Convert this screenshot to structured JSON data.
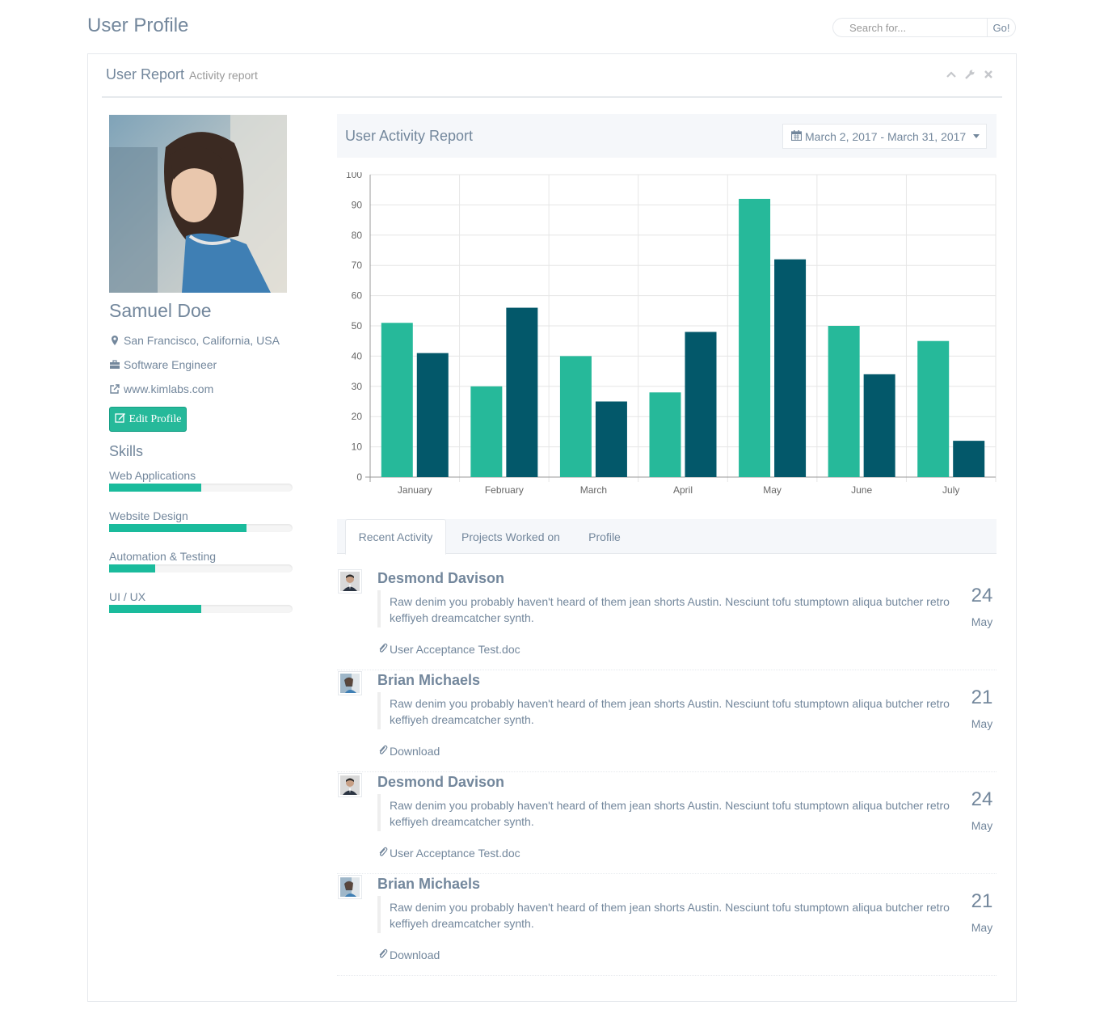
{
  "page": {
    "title": "User Profile"
  },
  "search": {
    "placeholder": "Search for...",
    "button": "Go!"
  },
  "panel": {
    "title": "User Report",
    "subtitle": "Activity report",
    "tools": [
      "chevron-up-icon",
      "wrench-icon",
      "close-icon"
    ]
  },
  "profile": {
    "name": "Samuel Doe",
    "location": "San Francisco, California, USA",
    "job": "Software Engineer",
    "website": "www.kimlabs.com",
    "edit_label": "Edit Profile",
    "skills_title": "Skills",
    "skills": [
      {
        "label": "Web Applications",
        "percent": 50
      },
      {
        "label": "Website Design",
        "percent": 75
      },
      {
        "label": "Automation & Testing",
        "percent": 25
      },
      {
        "label": "UI / UX",
        "percent": 50
      }
    ]
  },
  "report": {
    "title": "User Activity Report",
    "date_range": "March 2, 2017 - March 31, 2017"
  },
  "chart_data": {
    "type": "bar",
    "categories": [
      "January",
      "February",
      "March",
      "April",
      "May",
      "June",
      "July"
    ],
    "series": [
      {
        "values": [
          51,
          30,
          40,
          28,
          92,
          50,
          45
        ],
        "color": "#26B99A"
      },
      {
        "values": [
          41,
          56,
          25,
          48,
          72,
          34,
          12
        ],
        "color": "#03586A"
      }
    ],
    "ylim": [
      0,
      100
    ],
    "yticks": [
      0,
      10,
      20,
      30,
      40,
      50,
      60,
      70,
      80,
      90,
      100
    ],
    "grid": true
  },
  "tabs": [
    {
      "label": "Recent Activity",
      "active": true
    },
    {
      "label": "Projects Worked on",
      "active": false
    },
    {
      "label": "Profile",
      "active": false
    }
  ],
  "activities": [
    {
      "name": "Desmond Davison",
      "text": "Raw denim you probably haven't heard of them jean shorts Austin. Nesciunt tofu stumptown aliqua butcher retro keffiyeh dreamcatcher synth.",
      "attachment": "User Acceptance Test.doc",
      "day": "24",
      "month": "May"
    },
    {
      "name": "Brian Michaels",
      "text": "Raw denim you probably haven't heard of them jean shorts Austin. Nesciunt tofu stumptown aliqua butcher retro keffiyeh dreamcatcher synth.",
      "attachment": "Download",
      "day": "21",
      "month": "May"
    },
    {
      "name": "Desmond Davison",
      "text": "Raw denim you probably haven't heard of them jean shorts Austin. Nesciunt tofu stumptown aliqua butcher retro keffiyeh dreamcatcher synth.",
      "attachment": "User Acceptance Test.doc",
      "day": "24",
      "month": "May"
    },
    {
      "name": "Brian Michaels",
      "text": "Raw denim you probably haven't heard of them jean shorts Austin. Nesciunt tofu stumptown aliqua butcher retro keffiyeh dreamcatcher synth.",
      "attachment": "Download",
      "day": "21",
      "month": "May"
    }
  ]
}
